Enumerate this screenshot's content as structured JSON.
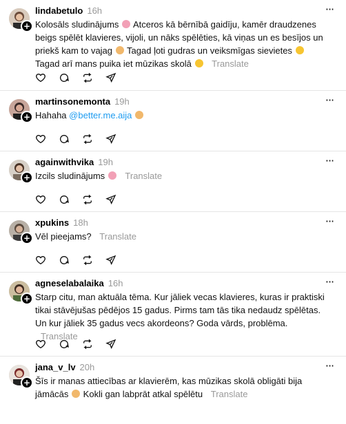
{
  "posts": [
    {
      "username": "lindabetulo",
      "time": "16h",
      "lines": [
        "Kolosāls sludinājums",
        "Atceros kā bērnībā gaidīju, kamēr draudzenes beigs",
        "spēlēt klavieres, vijoli, un nāks spēlēties, kā viņas un es besījos un priekš kam to",
        "vajag",
        "Tagad ļoti gudras un veiksmīgas sievietes",
        "Tagad arī mans puika iet",
        "mūzikas skolā"
      ],
      "translate": "Translate"
    },
    {
      "username": "martinsonemonta",
      "time": "19h",
      "lines": [
        "Hahaha",
        "@better.me.aija"
      ],
      "translate": ""
    },
    {
      "username": "againwithvika",
      "time": "19h",
      "lines": [
        "Izcils sludinājums"
      ],
      "translate": "Translate"
    },
    {
      "username": "xpukins",
      "time": "18h",
      "lines": [
        "Vēl pieejams?"
      ],
      "translate": "Translate"
    },
    {
      "username": "agneselabalaika",
      "time": "16h",
      "lines": [
        "Starp citu, man aktuāla tēma. Kur jāliek vecas klavieres, kuras ir praktiski tikai",
        "stāvējušas pēdējos 15 gadus. Pirms tam tās tika nedaudz spēlētas. Un kur jāliek 35",
        "gadus vecs akordeons? Goda vārds, problēma."
      ],
      "translate": "Translate"
    },
    {
      "username": "jana_v_lv",
      "time": "20h",
      "lines": [
        "Šīs ir manas attiecības ar klavierēm, kas mūzikas skolā obligāti bija jāmācās",
        "Kokli gan labprāt atkal spēlētu"
      ],
      "translate": "Translate"
    }
  ],
  "icons": {
    "more": "more-options-icon",
    "like": "heart-icon",
    "reply": "comment-icon",
    "repost": "repost-icon",
    "share": "send-icon",
    "follow": "plus-icon"
  },
  "colors": {
    "mention": "#1d9bf0",
    "muted": "#999999",
    "divider": "#e5e5e5"
  }
}
